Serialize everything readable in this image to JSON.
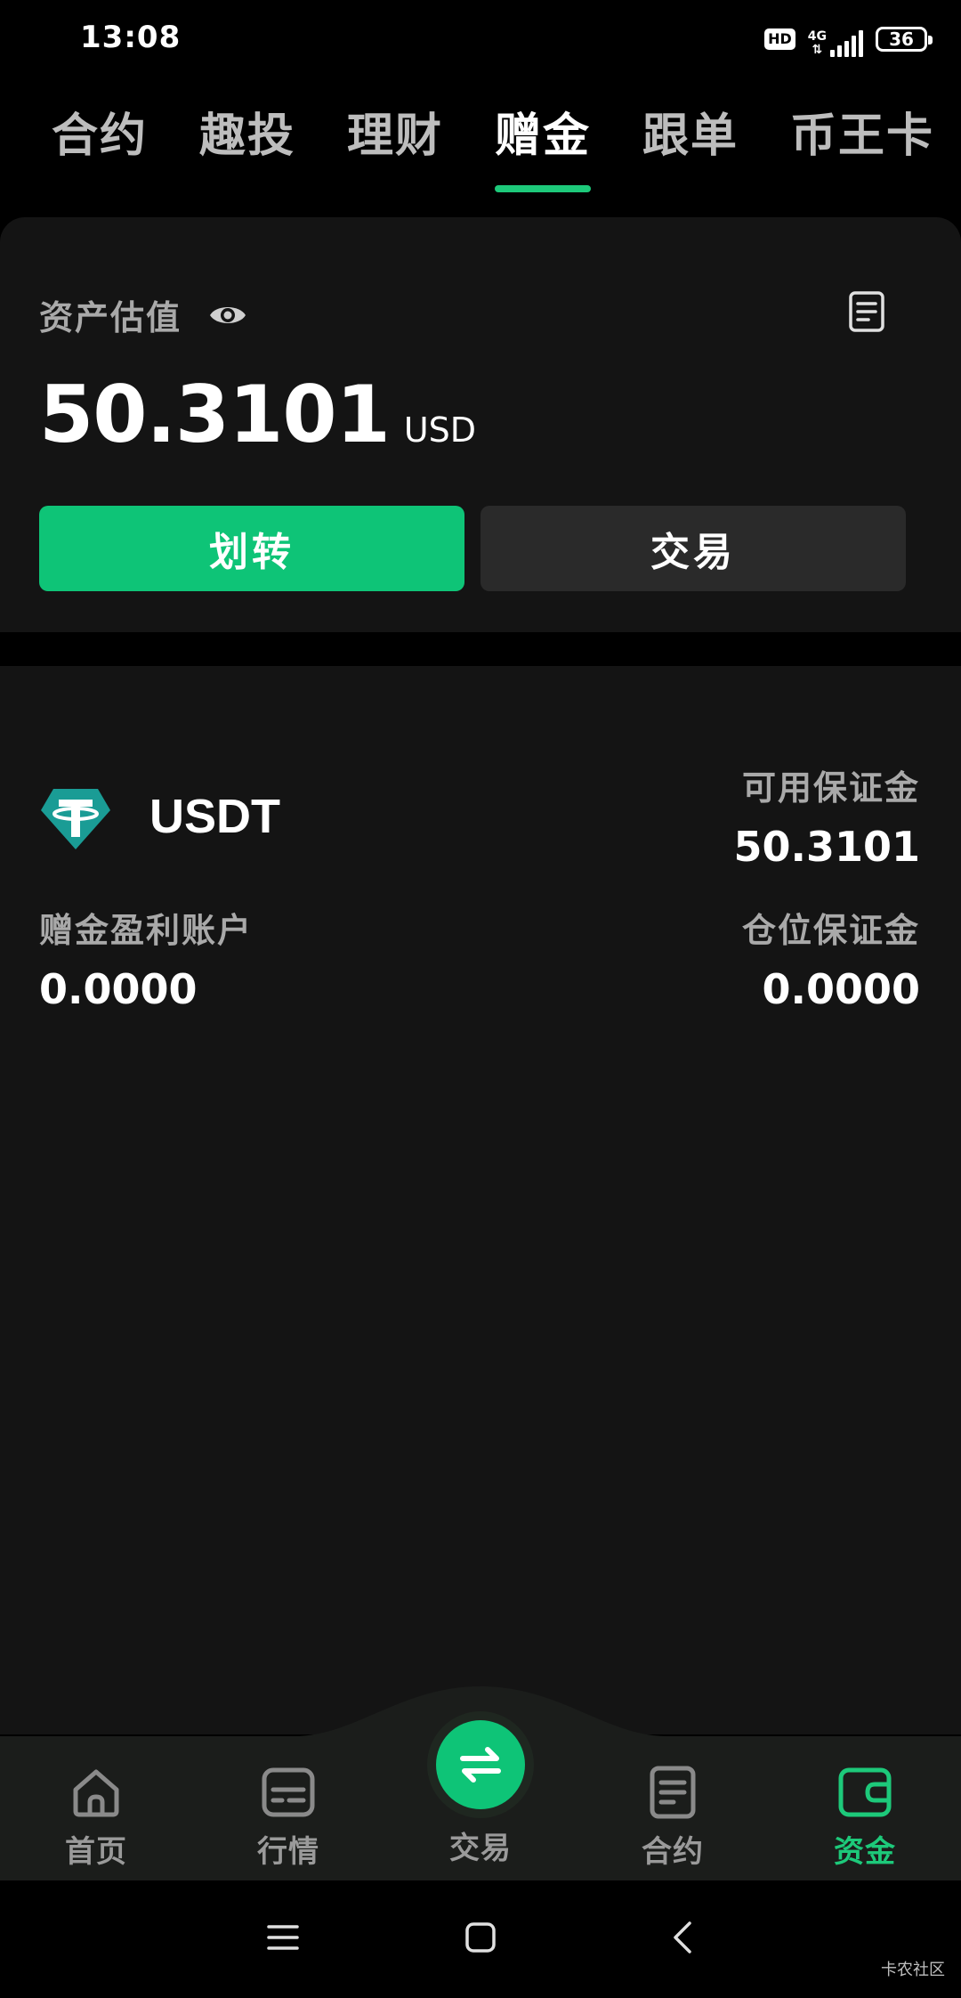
{
  "status_bar": {
    "time": "13:08",
    "hd": "HD",
    "network": "4G",
    "battery": "36"
  },
  "top_tabs": [
    {
      "label": "合约",
      "active": false
    },
    {
      "label": "趣投",
      "active": false
    },
    {
      "label": "理财",
      "active": false
    },
    {
      "label": "赠金",
      "active": true
    },
    {
      "label": "跟单",
      "active": false
    },
    {
      "label": "币王卡",
      "active": false
    }
  ],
  "asset": {
    "label": "资产估值",
    "value": "50.3101",
    "unit": "USD",
    "transfer_label": "划转",
    "trade_label": "交易"
  },
  "account": {
    "coin": "USDT",
    "available_margin_label": "可用保证金",
    "available_margin_value": "50.3101",
    "bonus_profit_label": "赠金盈利账户",
    "bonus_profit_value": "0.0000",
    "position_margin_label": "仓位保证金",
    "position_margin_value": "0.0000"
  },
  "bottom_nav": {
    "home": "首页",
    "market": "行情",
    "trade": "交易",
    "contract": "合约",
    "assets": "资金"
  },
  "watermark": "卡农社区",
  "colors": {
    "accent": "#0ec477",
    "background": "#141414",
    "muted_text": "#a9a9a9"
  }
}
